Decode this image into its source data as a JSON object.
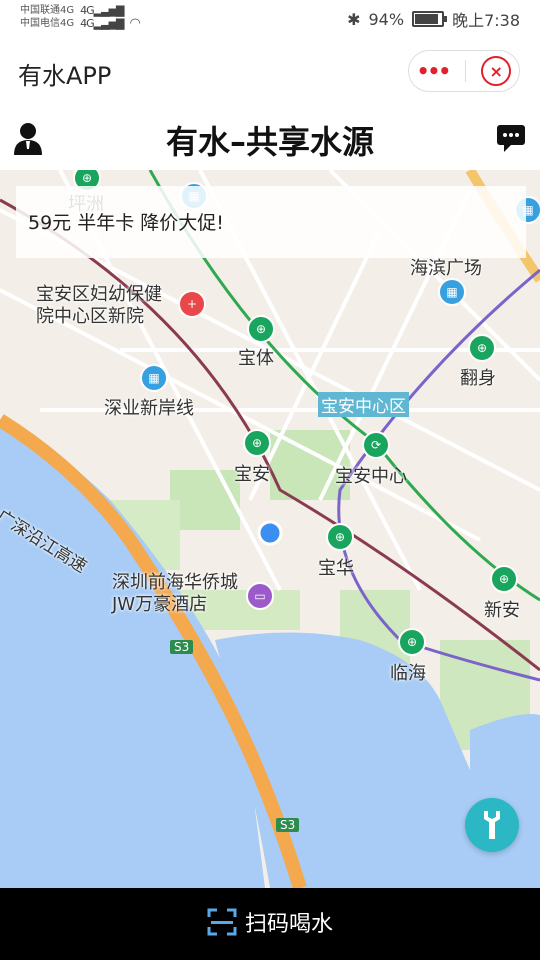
{
  "status": {
    "carrier1": "中国联通4G",
    "carrier2": "中国电信4G",
    "net1": "4G",
    "net2": "4G",
    "battery": "94%",
    "battery_level": 0.94,
    "time": "晚上7:38"
  },
  "appbar": {
    "title": "有水APP"
  },
  "header": {
    "title": "有水–共享水源"
  },
  "banner": {
    "text": "59元 半年卡 降价大促!"
  },
  "map": {
    "labels": {
      "pingzhou": "坪洲",
      "haibin": "海滨广场",
      "hospital": "宝安区妇幼保健院中心区新院",
      "baoti": "宝体",
      "fanshen": "翻身",
      "shenye": "深业新岸线",
      "bac": "宝安中心区",
      "baoan": "宝安",
      "baoan_center": "宝安中心",
      "baohua": "宝华",
      "xinan": "新安",
      "hotel": "深圳前海华侨城JW万豪酒店",
      "linhai": "临海",
      "s3a": "S3",
      "s3b": "S3",
      "road": "广深沿江高速"
    }
  },
  "bottom": {
    "scan_label": "扫码喝水"
  },
  "colors": {
    "teal": "#2bb8c4",
    "red": "#e0202b",
    "water": "#a8ccf5",
    "metro": "#1aa55e"
  }
}
